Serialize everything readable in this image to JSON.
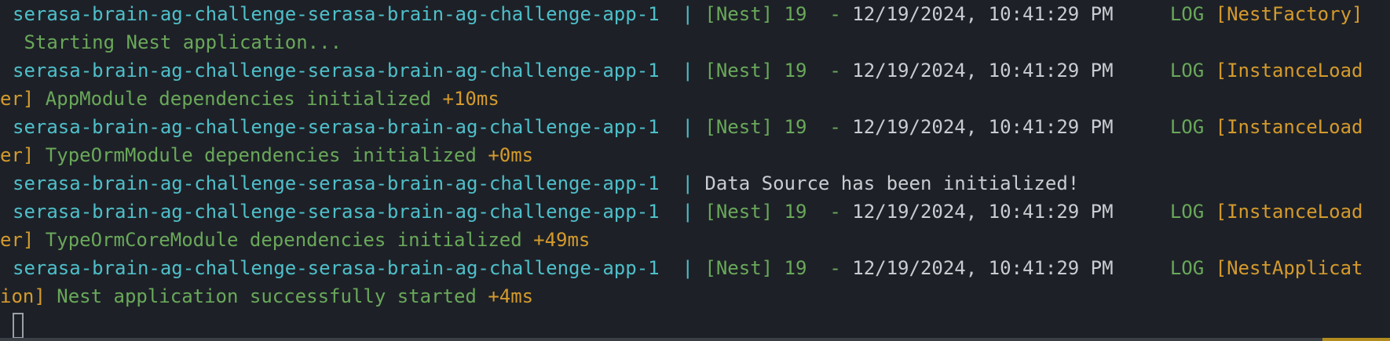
{
  "terminal": {
    "colors": {
      "background": "#1d2127",
      "container": "#4fbfca",
      "green": "#6aa85a",
      "orange": "#d59a2c",
      "white": "#c9ccd1"
    },
    "entries": [
      {
        "container": "serasa-brain-ag-challenge-serasa-brain-ag-challenge-app-1",
        "sep": "  | ",
        "nest": "[Nest] 19  - ",
        "timestamp": "12/19/2024, 10:41:29 PM",
        "level": "     LOG ",
        "context_a": "[NestFactory]",
        "context_b": "",
        "message": " Starting Nest application...",
        "timing": ""
      },
      {
        "container": "serasa-brain-ag-challenge-serasa-brain-ag-challenge-app-1",
        "sep": "  | ",
        "nest": "[Nest] 19  - ",
        "timestamp": "12/19/2024, 10:41:29 PM",
        "level": "     LOG ",
        "context_a": "[InstanceLoad",
        "context_b": "er]",
        "message": " AppModule dependencies initialized ",
        "timing": "+10ms"
      },
      {
        "container": "serasa-brain-ag-challenge-serasa-brain-ag-challenge-app-1",
        "sep": "  | ",
        "nest": "[Nest] 19  - ",
        "timestamp": "12/19/2024, 10:41:29 PM",
        "level": "     LOG ",
        "context_a": "[InstanceLoad",
        "context_b": "er]",
        "message": " TypeOrmModule dependencies initialized ",
        "timing": "+0ms"
      },
      {
        "container": "serasa-brain-ag-challenge-serasa-brain-ag-challenge-app-1",
        "sep": "  | ",
        "plain": "Data Source has been initialized!"
      },
      {
        "container": "serasa-brain-ag-challenge-serasa-brain-ag-challenge-app-1",
        "sep": "  | ",
        "nest": "[Nest] 19  - ",
        "timestamp": "12/19/2024, 10:41:29 PM",
        "level": "     LOG ",
        "context_a": "[InstanceLoad",
        "context_b": "er]",
        "message": " TypeOrmCoreModule dependencies initialized ",
        "timing": "+49ms"
      },
      {
        "container": "serasa-brain-ag-challenge-serasa-brain-ag-challenge-app-1",
        "sep": "  | ",
        "nest": "[Nest] 19  - ",
        "timestamp": "12/19/2024, 10:41:29 PM",
        "level": "     LOG ",
        "context_a": "[NestApplicat",
        "context_b": "ion]",
        "message": " Nest application successfully started ",
        "timing": "+4ms"
      }
    ]
  }
}
